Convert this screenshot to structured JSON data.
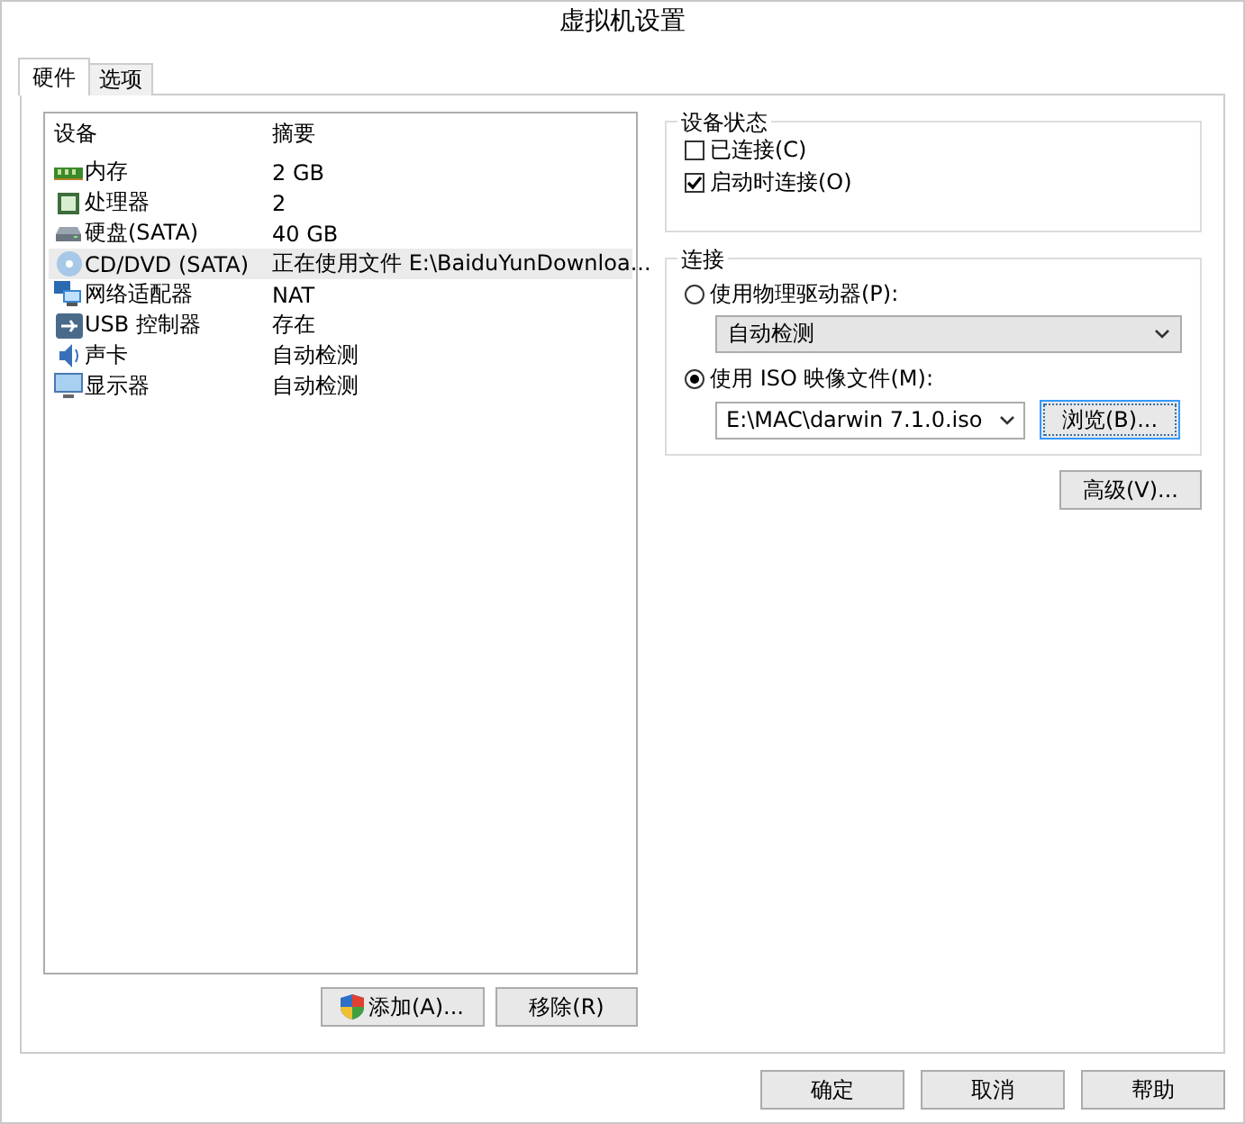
{
  "window": {
    "title": "虚拟机设置"
  },
  "tabs": [
    {
      "label": "硬件",
      "selected": true
    },
    {
      "label": "选项",
      "selected": false
    }
  ],
  "device_table": {
    "columns": [
      "设备",
      "摘要"
    ],
    "rows": [
      {
        "kind": "memory",
        "device": "内存",
        "summary": "2 GB",
        "selected": false
      },
      {
        "kind": "cpu",
        "device": "处理器",
        "summary": "2",
        "selected": false
      },
      {
        "kind": "disk",
        "device": "硬盘(SATA)",
        "summary": "40 GB",
        "selected": false
      },
      {
        "kind": "cdrom",
        "device": "CD/DVD (SATA)",
        "summary": "正在使用文件 E:\\BaiduYunDownloa...",
        "selected": true
      },
      {
        "kind": "network",
        "device": "网络适配器",
        "summary": "NAT",
        "selected": false
      },
      {
        "kind": "usb",
        "device": "USB 控制器",
        "summary": "存在",
        "selected": false
      },
      {
        "kind": "sound",
        "device": "声卡",
        "summary": "自动检测",
        "selected": false
      },
      {
        "kind": "display",
        "device": "显示器",
        "summary": "自动检测",
        "selected": false
      }
    ]
  },
  "list_buttons": [
    "添加(A)...",
    "移除(R)"
  ],
  "device_status": {
    "title": "设备状态",
    "options": [
      {
        "label": "已连接(C)",
        "checked": false
      },
      {
        "label": "启动时连接(O)",
        "checked": true
      }
    ]
  },
  "connection": {
    "title": "连接",
    "physical": {
      "label": "使用物理驱动器(P):",
      "selected": false,
      "dropdown": "自动检测"
    },
    "iso": {
      "label": "使用 ISO 映像文件(M):",
      "selected": true,
      "path": "E:\\MAC\\darwin 7.1.0.iso",
      "browse": "浏览(B)..."
    }
  },
  "advanced_button": "高级(V)...",
  "footer_buttons": [
    "确定",
    "取消",
    "帮助"
  ]
}
